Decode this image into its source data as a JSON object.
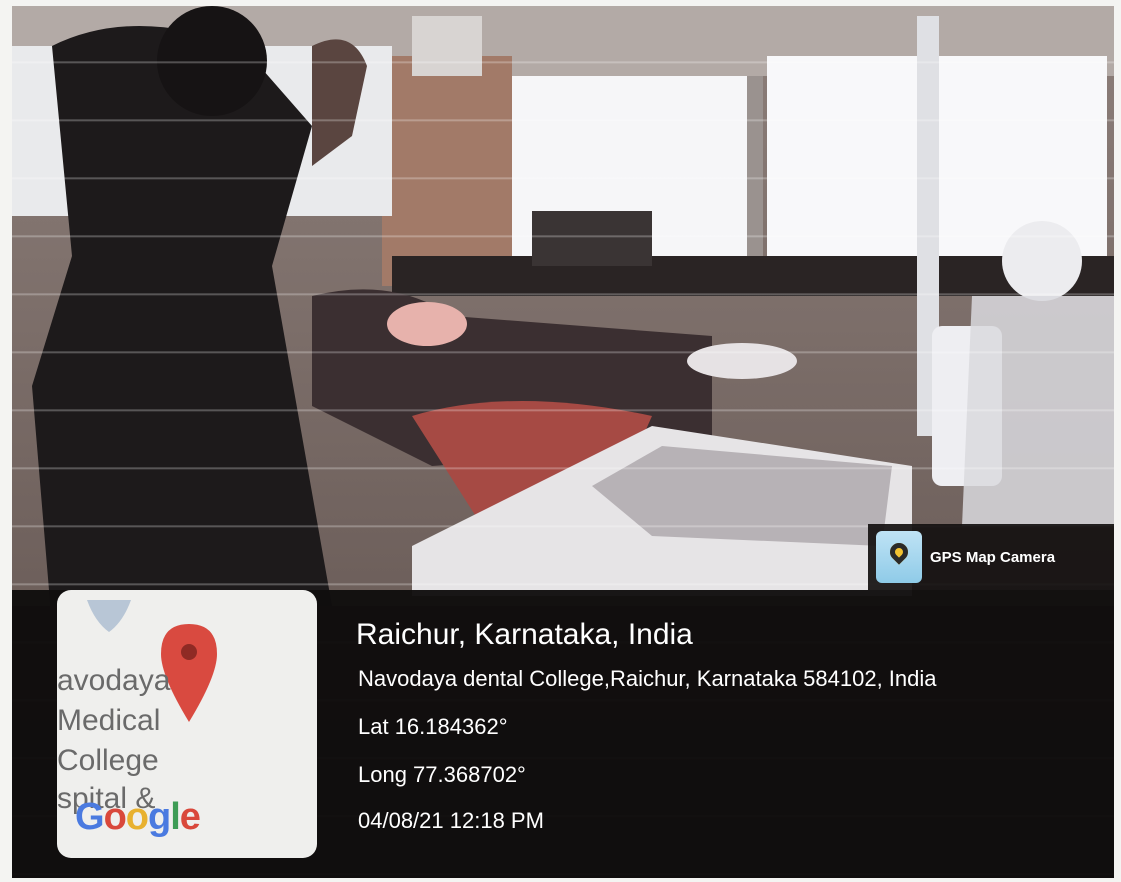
{
  "watermark": {
    "app_name": "GPS Map Camera",
    "app_icon": "gps-map-camera-icon"
  },
  "location": {
    "title": "Raichur, Karnataka, India",
    "address": "Navodaya dental College,Raichur, Karnataka 584102, India",
    "latitude": "Lat 16.184362°",
    "longitude": "Long 77.368702°",
    "datetime": "04/08/21 12:18 PM"
  },
  "map": {
    "label_lines": [
      "avodaya",
      "Medical",
      "College",
      "spital &"
    ],
    "provider_logo": "Google",
    "pin_icon": "map-pin-icon",
    "pin_color": "#d94a40"
  }
}
